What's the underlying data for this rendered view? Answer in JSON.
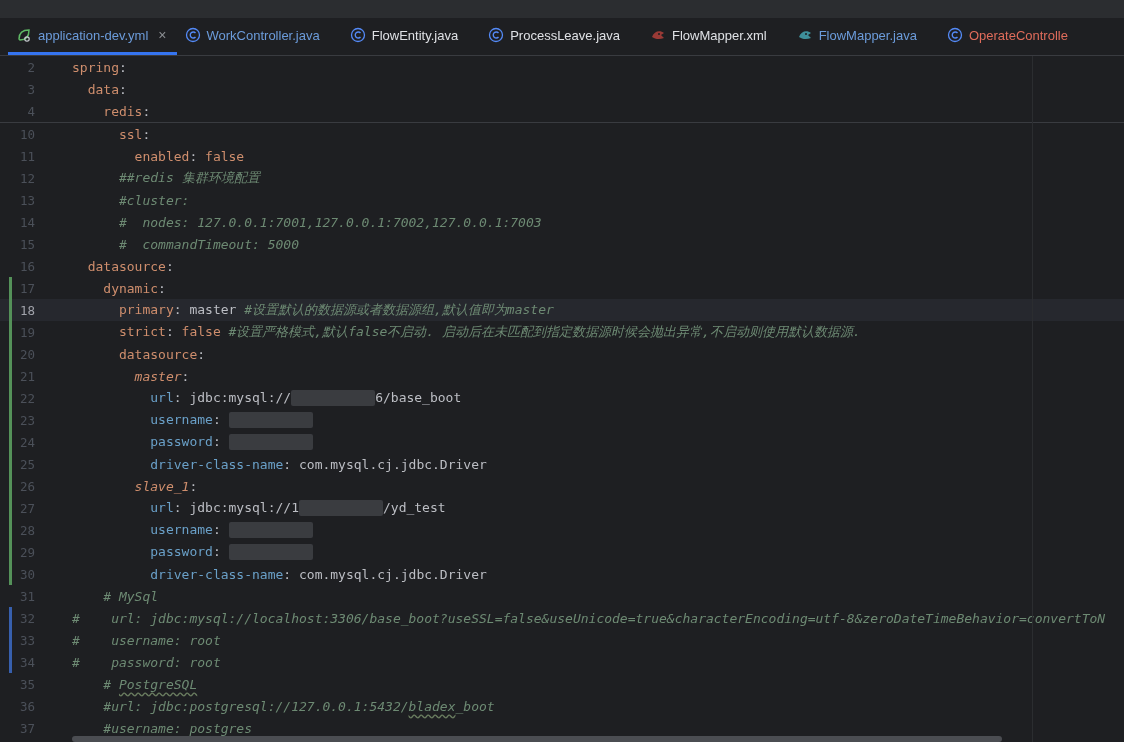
{
  "tabs": [
    {
      "label": "application-dev.yml",
      "kind": "yaml",
      "color": "#6c9cdb",
      "selected": true,
      "close": "×"
    },
    {
      "label": "WorkController.java",
      "kind": "class",
      "color": "#6c9cdb",
      "selected": false
    },
    {
      "label": "FlowEntity.java",
      "kind": "class",
      "color": "#dfe1e5",
      "selected": false
    },
    {
      "label": "ProcessLeave.java",
      "kind": "class",
      "color": "#dfe1e5",
      "selected": false
    },
    {
      "label": "FlowMapper.xml",
      "kind": "mapperxml",
      "color": "#dfe1e5",
      "selected": false
    },
    {
      "label": "FlowMapper.java",
      "kind": "mapper",
      "color": "#6c9cdb",
      "selected": false
    },
    {
      "label": "OperateControlle",
      "kind": "class",
      "color": "#e06c5b",
      "selected": false
    }
  ],
  "editor": {
    "sticky_lines": [
      {
        "number": "2",
        "tokens": [
          {
            "kind": "key",
            "text": "spring"
          },
          {
            "kind": "punct",
            "text": ":"
          }
        ]
      },
      {
        "number": "3",
        "tokens": [
          {
            "kind": "key",
            "text": "  data"
          },
          {
            "kind": "punct",
            "text": ":"
          }
        ]
      },
      {
        "number": "4",
        "tokens": [
          {
            "kind": "key",
            "text": "    redis"
          },
          {
            "kind": "punct",
            "text": ":"
          }
        ]
      }
    ],
    "lines": [
      {
        "number": "10",
        "kind": "plain",
        "current": false,
        "tokens": [
          {
            "kind": "key",
            "text": "      ssl"
          },
          {
            "kind": "punct",
            "text": ":"
          }
        ]
      },
      {
        "number": "11",
        "kind": "plain",
        "current": false,
        "tokens": [
          {
            "kind": "key",
            "text": "        enabled"
          },
          {
            "kind": "punct",
            "text": ": "
          },
          {
            "kind": "bool",
            "text": "false"
          }
        ]
      },
      {
        "number": "12",
        "kind": "plain",
        "current": false,
        "tokens": [
          {
            "kind": "comment",
            "text": "      ##redis 集群环境配置"
          }
        ]
      },
      {
        "number": "13",
        "kind": "plain",
        "current": false,
        "tokens": [
          {
            "kind": "comment",
            "text": "      #cluster:"
          }
        ]
      },
      {
        "number": "14",
        "kind": "plain",
        "current": false,
        "tokens": [
          {
            "kind": "comment",
            "text": "      #  nodes: 127.0.0.1:7001,127.0.0.1:7002,127.0.0.1:7003"
          }
        ]
      },
      {
        "number": "15",
        "kind": "plain",
        "current": false,
        "tokens": [
          {
            "kind": "comment",
            "text": "      #  commandTimeout: 5000"
          }
        ]
      },
      {
        "number": "16",
        "kind": "plain",
        "current": false,
        "tokens": [
          {
            "kind": "key",
            "text": "  datasource"
          },
          {
            "kind": "punct",
            "text": ":"
          }
        ]
      },
      {
        "number": "17",
        "kind": "added",
        "current": false,
        "tokens": [
          {
            "kind": "key",
            "text": "    dynamic"
          },
          {
            "kind": "punct",
            "text": ":"
          }
        ]
      },
      {
        "number": "18",
        "kind": "added",
        "current": true,
        "tokens": [
          {
            "kind": "key",
            "text": "      primary"
          },
          {
            "kind": "punct",
            "text": ": "
          },
          {
            "kind": "value",
            "text": "master "
          },
          {
            "kind": "comment",
            "text": "#设置默认的数据源或者数据源组,默认值即为master"
          }
        ]
      },
      {
        "number": "19",
        "kind": "added",
        "current": false,
        "tokens": [
          {
            "kind": "key",
            "text": "      strict"
          },
          {
            "kind": "punct",
            "text": ": "
          },
          {
            "kind": "bool",
            "text": "false "
          },
          {
            "kind": "comment",
            "text": "#设置严格模式,默认false不启动. 启动后在未匹配到指定数据源时候会抛出异常,不启动则使用默认数据源."
          }
        ]
      },
      {
        "number": "20",
        "kind": "added",
        "current": false,
        "tokens": [
          {
            "kind": "key",
            "text": "      datasource"
          },
          {
            "kind": "punct",
            "text": ":"
          }
        ]
      },
      {
        "number": "21",
        "kind": "added",
        "current": false,
        "tokens": [
          {
            "kind": "anchor",
            "text": "        master"
          },
          {
            "kind": "punct",
            "text": ":"
          }
        ]
      },
      {
        "number": "22",
        "kind": "added",
        "current": false,
        "tokens": [
          {
            "kind": "prop",
            "text": "          url"
          },
          {
            "kind": "punct",
            "text": ": "
          },
          {
            "kind": "value",
            "text": "jdbc:mysql://"
          },
          {
            "kind": "redacted"
          },
          {
            "kind": "value",
            "text": "6/base_boot"
          }
        ]
      },
      {
        "number": "23",
        "kind": "added",
        "current": false,
        "tokens": [
          {
            "kind": "prop",
            "text": "          username"
          },
          {
            "kind": "punct",
            "text": ": "
          },
          {
            "kind": "redacted"
          }
        ]
      },
      {
        "number": "24",
        "kind": "added",
        "current": false,
        "tokens": [
          {
            "kind": "prop",
            "text": "          password"
          },
          {
            "kind": "punct",
            "text": ": "
          },
          {
            "kind": "redacted"
          }
        ]
      },
      {
        "number": "25",
        "kind": "added",
        "current": false,
        "tokens": [
          {
            "kind": "prop",
            "text": "          driver-class-name"
          },
          {
            "kind": "punct",
            "text": ": "
          },
          {
            "kind": "value",
            "text": "com.mysql.cj.jdbc.Driver"
          }
        ]
      },
      {
        "number": "26",
        "kind": "added",
        "current": false,
        "tokens": [
          {
            "kind": "anchor",
            "text": "        slave_1"
          },
          {
            "kind": "punct",
            "text": ":"
          }
        ]
      },
      {
        "number": "27",
        "kind": "added",
        "current": false,
        "tokens": [
          {
            "kind": "prop",
            "text": "          url"
          },
          {
            "kind": "punct",
            "text": ": "
          },
          {
            "kind": "value",
            "text": "jdbc:mysql://1"
          },
          {
            "kind": "redacted"
          },
          {
            "kind": "value",
            "text": "/yd_test"
          }
        ]
      },
      {
        "number": "28",
        "kind": "added",
        "current": false,
        "tokens": [
          {
            "kind": "prop",
            "text": "          username"
          },
          {
            "kind": "punct",
            "text": ": "
          },
          {
            "kind": "redacted"
          }
        ]
      },
      {
        "number": "29",
        "kind": "added",
        "current": false,
        "tokens": [
          {
            "kind": "prop",
            "text": "          password"
          },
          {
            "kind": "punct",
            "text": ": "
          },
          {
            "kind": "redacted"
          }
        ]
      },
      {
        "number": "30",
        "kind": "added",
        "current": false,
        "tokens": [
          {
            "kind": "prop",
            "text": "          driver-class-name"
          },
          {
            "kind": "punct",
            "text": ": "
          },
          {
            "kind": "value",
            "text": "com.mysql.cj.jdbc.Driver"
          }
        ]
      },
      {
        "number": "31",
        "kind": "plain",
        "current": false,
        "tokens": [
          {
            "kind": "comment",
            "text": "    # MySql"
          }
        ]
      },
      {
        "number": "32",
        "kind": "modified",
        "current": false,
        "tokens": [
          {
            "kind": "comment",
            "text": "#    url: jdbc:mysql://localhost:3306/base_boot?useSSL=false&useUnicode=true&characterEncoding=utf-8&zeroDateTimeBehavior=convertToN"
          }
        ]
      },
      {
        "number": "33",
        "kind": "modified",
        "current": false,
        "tokens": [
          {
            "kind": "comment",
            "text": "#    username: root"
          }
        ]
      },
      {
        "number": "34",
        "kind": "modified",
        "current": false,
        "tokens": [
          {
            "kind": "comment",
            "text": "#    password: root"
          }
        ]
      },
      {
        "number": "35",
        "kind": "plain",
        "current": false,
        "tokens": [
          {
            "kind": "comment",
            "text": "    # "
          },
          {
            "kind": "typo",
            "text": "PostgreSQL"
          }
        ]
      },
      {
        "number": "36",
        "kind": "plain",
        "current": false,
        "tokens": [
          {
            "kind": "comment",
            "text": "    #url: jdbc:postgresql://127.0.0.1:5432/"
          },
          {
            "kind": "typo",
            "text": "bladex"
          },
          {
            "kind": "comment",
            "text": "_boot"
          }
        ]
      },
      {
        "number": "37",
        "kind": "plain",
        "current": false,
        "tokens": [
          {
            "kind": "comment",
            "text": "    #username: postgres"
          }
        ]
      }
    ]
  }
}
